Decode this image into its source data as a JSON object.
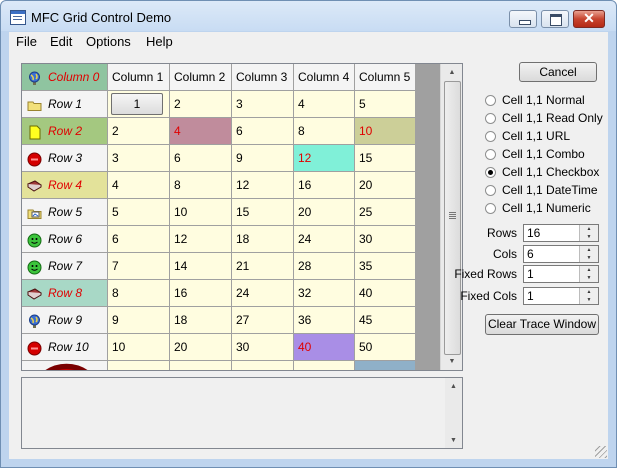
{
  "window": {
    "title": "MFC Grid Control Demo"
  },
  "menu": [
    "File",
    "Edit",
    "Options",
    "Help"
  ],
  "grid": {
    "corner_label": "Column 0",
    "columns": [
      "Column 1",
      "Column 2",
      "Column 3",
      "Column 4",
      "Column 5"
    ],
    "button_cell_value": "1",
    "rows": [
      {
        "label": "Row 1",
        "values": [
          "1",
          "2",
          "3",
          "4",
          "5"
        ]
      },
      {
        "label": "Row 2",
        "values": [
          "2",
          "4",
          "6",
          "8",
          "10"
        ]
      },
      {
        "label": "Row 3",
        "values": [
          "3",
          "6",
          "9",
          "12",
          "15"
        ]
      },
      {
        "label": "Row 4",
        "values": [
          "4",
          "8",
          "12",
          "16",
          "20"
        ]
      },
      {
        "label": "Row 5",
        "values": [
          "5",
          "10",
          "15",
          "20",
          "25"
        ]
      },
      {
        "label": "Row 6",
        "values": [
          "6",
          "12",
          "18",
          "24",
          "30"
        ]
      },
      {
        "label": "Row 7",
        "values": [
          "7",
          "14",
          "21",
          "28",
          "35"
        ]
      },
      {
        "label": "Row 8",
        "values": [
          "8",
          "16",
          "24",
          "32",
          "40"
        ]
      },
      {
        "label": "Row 9",
        "values": [
          "9",
          "18",
          "27",
          "36",
          "45"
        ]
      },
      {
        "label": "Row 10",
        "values": [
          "10",
          "20",
          "30",
          "40",
          "50"
        ]
      }
    ]
  },
  "colors": {
    "cell_background": "#fffde0",
    "header_background": "#f4f4f4",
    "red_text": "#e00000",
    "corner_header": "#8fc4a0",
    "row2_header": "#a4c880",
    "row4_header": "#e3e29a",
    "row8_header": "#a8d8c6",
    "row2_col2": "#c08c9c",
    "row2_col5": "#cccf98",
    "row3_col4": "#80f0d8",
    "row10_col4": "#a98ee6"
  },
  "row_icons": [
    "globe-icon",
    "folder-icon",
    "note-icon",
    "stop-icon",
    "book-icon",
    "folder-image-icon",
    "go-icon",
    "go-icon",
    "book-icon",
    "globe-icon",
    "stop-icon"
  ],
  "controls": {
    "cancel": "Cancel",
    "radios": [
      {
        "label": "Cell 1,1 Normal",
        "checked": false
      },
      {
        "label": "Cell 1,1 Read Only",
        "checked": false
      },
      {
        "label": "Cell 1,1 URL",
        "checked": false
      },
      {
        "label": "Cell 1,1 Combo",
        "checked": false
      },
      {
        "label": "Cell 1,1 Checkbox",
        "checked": true
      },
      {
        "label": "Cell 1,1 DateTime",
        "checked": false
      },
      {
        "label": "Cell 1,1 Numeric",
        "checked": false
      }
    ],
    "fields": [
      {
        "label": "Rows",
        "value": "16"
      },
      {
        "label": "Cols",
        "value": "6"
      },
      {
        "label": "Fixed Rows",
        "value": "1"
      },
      {
        "label": "Fixed Cols",
        "value": "1"
      }
    ],
    "clear_trace": "Clear Trace Window"
  }
}
